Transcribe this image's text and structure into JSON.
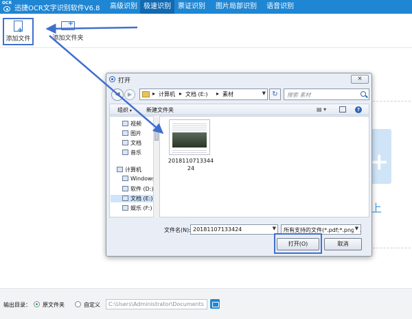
{
  "app": {
    "logo_text": "OCR",
    "title": "迅捷OCR文字识别软件V6.8"
  },
  "menu": [
    {
      "label": "高级识别"
    },
    {
      "label": "极速识别"
    },
    {
      "label": "票证识别"
    },
    {
      "label": "图片局部识别"
    },
    {
      "label": "语音识别"
    }
  ],
  "toolbar": {
    "add_file_label": "添加文件",
    "add_folder_label": "添加文件夹"
  },
  "background": {
    "drop_text": "上"
  },
  "dialog": {
    "title": "打开",
    "close_label": "×",
    "breadcrumb": [
      "计算机",
      "文档 (E:)",
      "素材"
    ],
    "search_placeholder": "搜索 素材",
    "organize_label": "组织",
    "new_folder_label": "新建文件夹",
    "view_label": "▤ ▾",
    "help_label": "?",
    "nav_items": [
      {
        "label": "视频"
      },
      {
        "label": "图片"
      },
      {
        "label": "文档"
      },
      {
        "label": "音乐"
      },
      {
        "label": "计算机"
      },
      {
        "label": "Windows"
      },
      {
        "label": "软件 (D:)"
      },
      {
        "label": "文档 (E:)"
      },
      {
        "label": "娱乐 (F:)"
      }
    ],
    "file": {
      "name": "201811071334424"
    },
    "filename_label": "文件名(N):",
    "filename_value": "20181107133424",
    "filetype_value": "所有支持的文件(*.pdf;*.png;*.j",
    "open_label": "打开(O)",
    "cancel_label": "取消"
  },
  "bottom": {
    "output_label": "输出目录：",
    "original_folder_label": "原文件夹",
    "custom_label": "自定义",
    "path_value": "C:\\Users\\Administrator\\Documents"
  },
  "colors": {
    "accent": "#1f86d3",
    "highlight_box": "#3f6fcf"
  }
}
